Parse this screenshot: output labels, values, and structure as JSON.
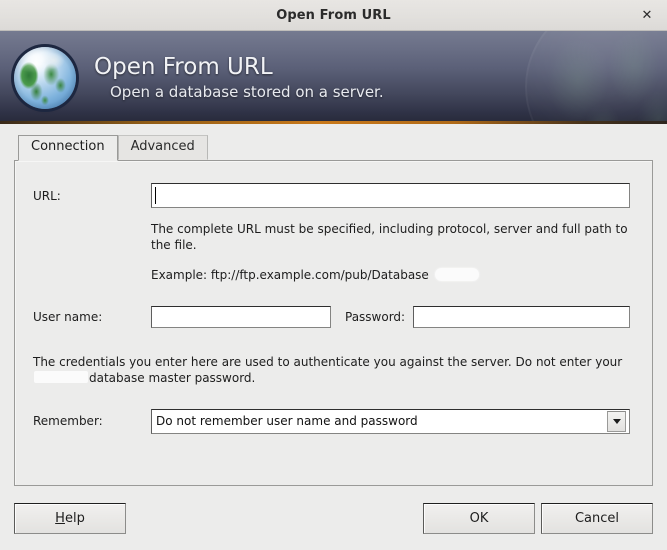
{
  "window": {
    "title": "Open From URL",
    "close_icon": "close-icon"
  },
  "banner": {
    "icon": "globe-icon",
    "title": "Open From URL",
    "subtitle": "Open a database stored on a server.",
    "accent_color": "#c9791a",
    "gradient_top": "#757a90",
    "gradient_bottom": "#262938"
  },
  "tabs": [
    {
      "label": "Connection",
      "active": true
    },
    {
      "label": "Advanced",
      "active": false
    }
  ],
  "form": {
    "url": {
      "label": "URL:",
      "value": "",
      "placeholder": "",
      "focused": true
    },
    "url_help": "The complete URL must be specified, including protocol, server and full path to the file.",
    "url_example_prefix": "Example: ftp://ftp.example.com/pub/Database",
    "url_example_redacted": "",
    "user_name": {
      "label": "User name:",
      "value": "",
      "placeholder": ""
    },
    "password": {
      "label": "Password:",
      "value": "",
      "placeholder": ""
    },
    "credentials_note_part1": "The credentials you enter here are used to authenticate you against the server. Do not enter your",
    "credentials_note_redacted": "",
    "credentials_note_part2": "database master password.",
    "remember": {
      "label": "Remember:",
      "value": "Do not remember user name and password",
      "arrow_icon": "chevron-down-icon",
      "options": [
        "Do not remember user name and password"
      ]
    }
  },
  "footer": {
    "help_mnemonic": "H",
    "help_rest": "elp",
    "ok_label": "OK",
    "cancel_label": "Cancel"
  }
}
